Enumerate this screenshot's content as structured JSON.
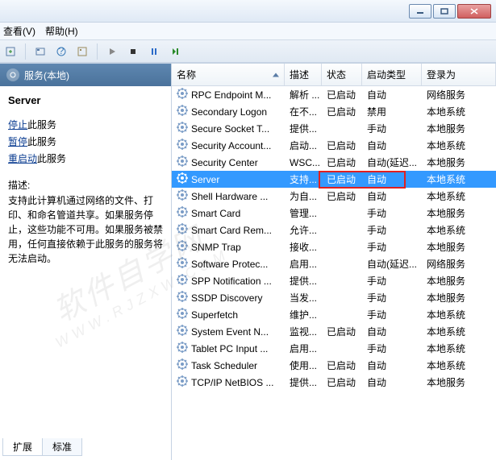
{
  "menu": {
    "view": "查看(V)",
    "help": "帮助(H)"
  },
  "left": {
    "header": "服务(本地)",
    "title": "Server",
    "stop_pre": "停止",
    "stop_post": "此服务",
    "pause_pre": "暂停",
    "pause_post": "此服务",
    "restart_pre": "重启动",
    "restart_post": "此服务",
    "desc_label": "描述:",
    "desc_text": "支持此计算机通过网络的文件、打印、和命名管道共享。如果服务停止，这些功能不可用。如果服务被禁用，任何直接依赖于此服务的服务将无法启动。"
  },
  "columns": {
    "name": "名称",
    "desc": "描述",
    "status": "状态",
    "startup": "启动类型",
    "logon": "登录为"
  },
  "rows": [
    {
      "n": "RPC Endpoint M...",
      "d": "解析 ...",
      "s": "已启动",
      "t": "自动",
      "l": "网络服务"
    },
    {
      "n": "Secondary Logon",
      "d": "在不...",
      "s": "已启动",
      "t": "禁用",
      "l": "本地系统"
    },
    {
      "n": "Secure Socket T...",
      "d": "提供...",
      "s": "",
      "t": "手动",
      "l": "本地服务"
    },
    {
      "n": "Security Account...",
      "d": "启动...",
      "s": "已启动",
      "t": "自动",
      "l": "本地系统"
    },
    {
      "n": "Security Center",
      "d": "WSC...",
      "s": "已启动",
      "t": "自动(延迟...",
      "l": "本地服务"
    },
    {
      "n": "Server",
      "d": "支持...",
      "s": "已启动",
      "t": "自动",
      "l": "本地系统",
      "sel": true
    },
    {
      "n": "Shell Hardware ...",
      "d": "为自...",
      "s": "已启动",
      "t": "自动",
      "l": "本地系统"
    },
    {
      "n": "Smart Card",
      "d": "管理...",
      "s": "",
      "t": "手动",
      "l": "本地服务"
    },
    {
      "n": "Smart Card Rem...",
      "d": "允许...",
      "s": "",
      "t": "手动",
      "l": "本地系统"
    },
    {
      "n": "SNMP Trap",
      "d": "接收...",
      "s": "",
      "t": "手动",
      "l": "本地服务"
    },
    {
      "n": "Software Protec...",
      "d": "启用...",
      "s": "",
      "t": "自动(延迟...",
      "l": "网络服务"
    },
    {
      "n": "SPP Notification ...",
      "d": "提供...",
      "s": "",
      "t": "手动",
      "l": "本地服务"
    },
    {
      "n": "SSDP Discovery",
      "d": "当发...",
      "s": "",
      "t": "手动",
      "l": "本地服务"
    },
    {
      "n": "Superfetch",
      "d": "维护...",
      "s": "",
      "t": "手动",
      "l": "本地系统"
    },
    {
      "n": "System Event N...",
      "d": "监视...",
      "s": "已启动",
      "t": "自动",
      "l": "本地系统"
    },
    {
      "n": "Tablet PC Input ...",
      "d": "启用...",
      "s": "",
      "t": "手动",
      "l": "本地系统"
    },
    {
      "n": "Task Scheduler",
      "d": "使用...",
      "s": "已启动",
      "t": "自动",
      "l": "本地系统"
    },
    {
      "n": "TCP/IP NetBIOS ...",
      "d": "提供...",
      "s": "已启动",
      "t": "自动",
      "l": "本地服务"
    }
  ],
  "tabs": {
    "extended": "扩展",
    "standard": "标准"
  },
  "watermark": {
    "main": "软件自学网",
    "sub": "WWW.RJZXW.COM"
  }
}
